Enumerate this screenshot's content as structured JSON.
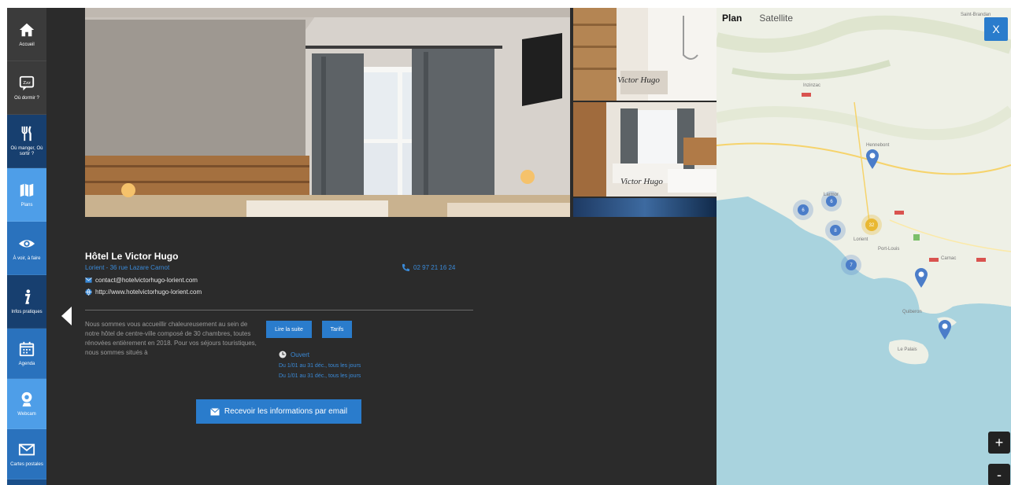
{
  "sidebar": {
    "items": [
      {
        "label": "Accueil",
        "icon": "home-icon"
      },
      {
        "label": "Où dormir ?",
        "icon": "chat-icon",
        "badge": "Zzz"
      },
      {
        "label": "Où manger, Où sortir ?",
        "icon": "fork-knife-icon"
      },
      {
        "label": "Plans",
        "icon": "map-icon"
      },
      {
        "label": "À voir, à faire",
        "icon": "eye-icon"
      },
      {
        "label": "Infos pratiques",
        "icon": "info-icon"
      },
      {
        "label": "Agenda",
        "icon": "calendar-icon"
      },
      {
        "label": "Webcam",
        "icon": "webcam-icon"
      },
      {
        "label": "Cartes postales",
        "icon": "mail-icon"
      }
    ]
  },
  "hotel": {
    "name": "Hôtel Le Victor Hugo",
    "address": "Lorient - 36 rue Lazare Carnot",
    "email": "contact@hotelvictorhugo-lorient.com",
    "website": "http://www.hotelvictorhugo-lorient.com",
    "phone": "02 97 21 16 24",
    "description": "Nous sommes vous accueillir chaleureusement au sein de notre hôtel de centre-ville composé de 30 chambres, toutes rénovées entièrement en 2018. Pour vos séjours touristiques, nous sommes situés à",
    "more_label": "Lire la suite",
    "tariffs_label": "Tarifs",
    "status": "Ouvert",
    "hours": [
      "Du 1/01 au 31 déc., tous les jours",
      "Du 1/01 au 31 déc., tous les jours"
    ],
    "email_button": "Recevoir les informations par email",
    "photo_captions": [
      "Victor Hugo",
      "Victor Hugo"
    ]
  },
  "map": {
    "tabs": [
      "Plan",
      "Satellite"
    ],
    "close_label": "X",
    "zoom_in": "+",
    "zoom_out": "-",
    "places": [
      "Saint-Brandan",
      "Inzinzac",
      "Hennebont",
      "Lorient",
      "Port-Louis",
      "Larmor",
      "Carnac",
      "Quiberon",
      "Le Palais"
    ],
    "clusters": [
      {
        "count": "6"
      },
      {
        "count": "6"
      },
      {
        "count": "8"
      },
      {
        "count": "32"
      },
      {
        "count": "7"
      }
    ],
    "colors": {
      "sea": "#a9d3de",
      "land": "#eef0e6",
      "cluster_blue": "#4b7dc9",
      "cluster_yellow": "#e9b832"
    }
  }
}
